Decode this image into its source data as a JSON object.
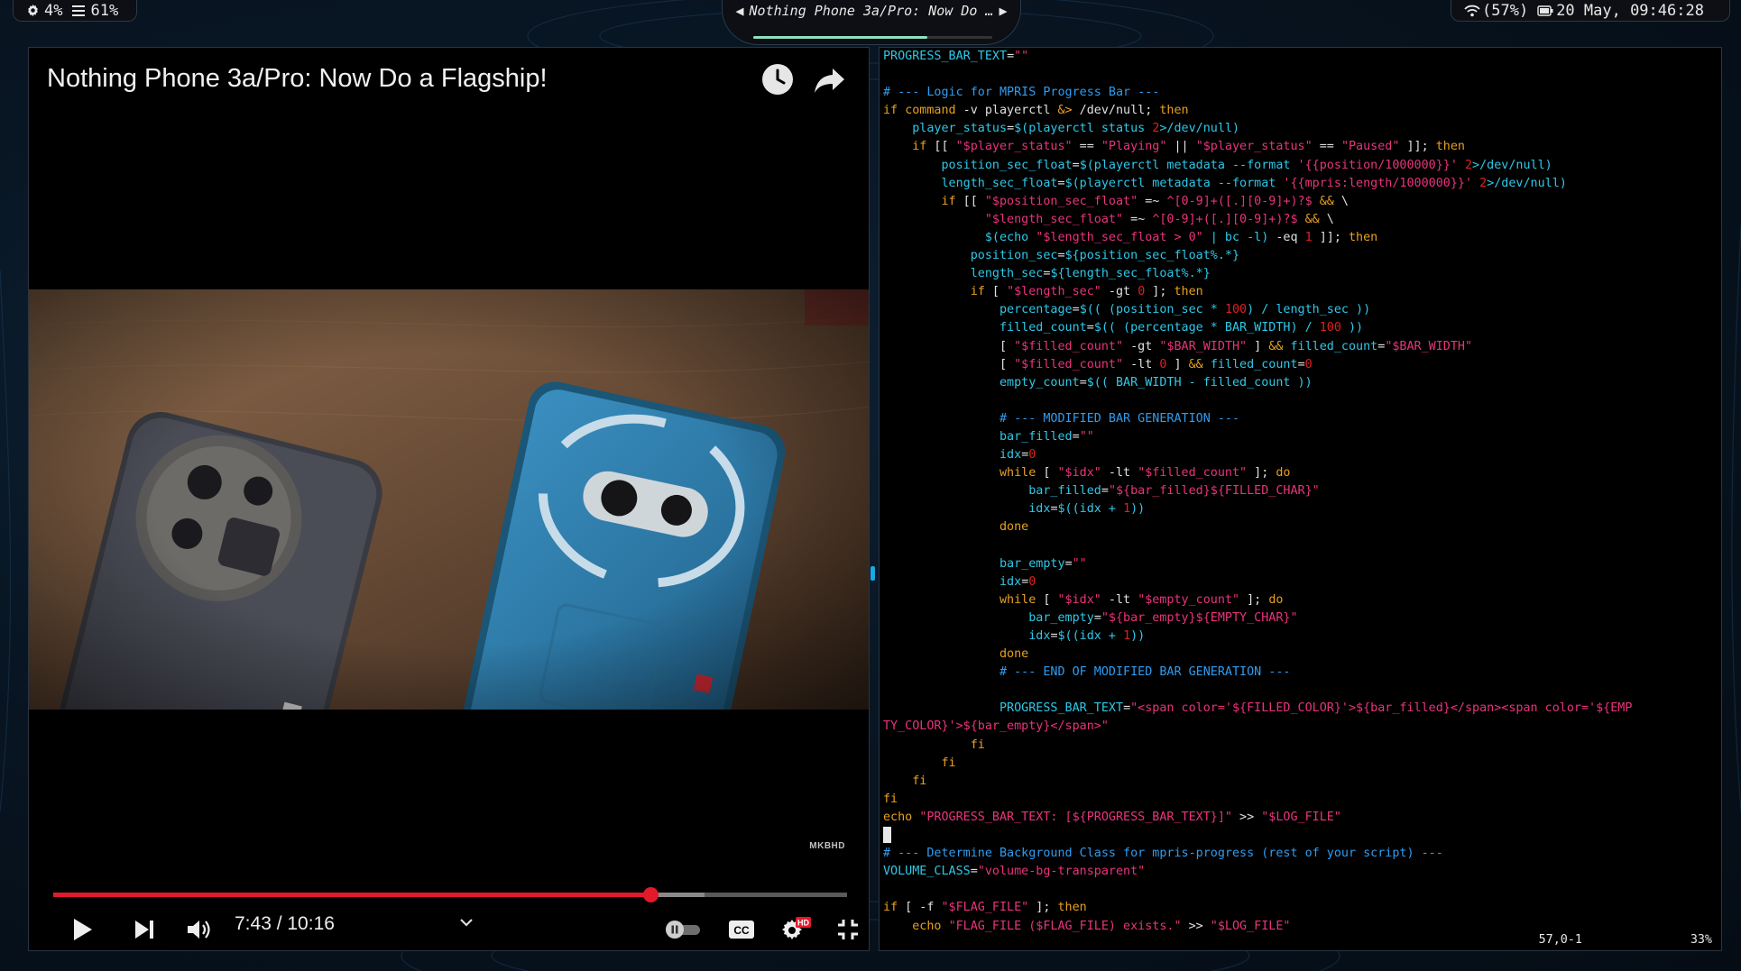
{
  "topbar": {
    "cpu_icon": "gear-icon",
    "cpu": "4%",
    "mem_icon": "menu-icon",
    "mem": "61%",
    "media_prev": "◀",
    "media_title": "Nothing Phone 3a/Pro: Now Do …",
    "media_next": "▶",
    "media_progress": 0.73,
    "wifi_icon": "wifi-icon",
    "wifi": "(57%)",
    "battery_icon": "battery-icon",
    "datetime": "20 May, 09:46:28"
  },
  "video": {
    "title": "Nothing Phone 3a/Pro: Now Do a Flagship!",
    "watch_later_icon": "clock-icon",
    "share_icon": "share-icon",
    "watermark": "MKBHD",
    "time": "7:43 / 10:16",
    "progress": 0.7524,
    "buffered": 0.82,
    "controls": [
      "play-icon",
      "next-icon",
      "volume-icon",
      "chevron-down-icon",
      "autoplay-toggle",
      "cc-icon",
      "settings-icon",
      "exit-fullscreen-icon"
    ],
    "hd_badge": "HD",
    "cc_label": "CC",
    "colors": {
      "played": "#e21a2c"
    }
  },
  "terminal": {
    "lines": [
      [
        [
          "var",
          "PROGRESS_BAR_TEXT"
        ],
        [
          "op",
          "="
        ],
        [
          "str",
          "\"\""
        ]
      ],
      [],
      [
        [
          "cm",
          "# --- Logic for MPRIS Progress Bar ---"
        ]
      ],
      [
        [
          "kw",
          "if"
        ],
        [
          "op",
          " "
        ],
        [
          "kw",
          "command"
        ],
        [
          "op",
          " -v playerctl "
        ],
        [
          "kw",
          "&>"
        ],
        [
          "op",
          " /dev/null; "
        ],
        [
          "kw",
          "then"
        ]
      ],
      [
        [
          "op",
          "    "
        ],
        [
          "var",
          "player_status"
        ],
        [
          "op",
          "="
        ],
        [
          "var",
          "$(playerctl status "
        ],
        [
          "num",
          "2"
        ],
        [
          "var",
          ">/dev/null)"
        ]
      ],
      [
        [
          "op",
          "    "
        ],
        [
          "kw",
          "if"
        ],
        [
          "op",
          " [[ "
        ],
        [
          "str",
          "\"$player_status\""
        ],
        [
          "op",
          " == "
        ],
        [
          "str",
          "\"Playing\""
        ],
        [
          "op",
          " || "
        ],
        [
          "str",
          "\"$player_status\""
        ],
        [
          "op",
          " == "
        ],
        [
          "str",
          "\"Paused\""
        ],
        [
          "op",
          " ]]; "
        ],
        [
          "kw",
          "then"
        ]
      ],
      [
        [
          "op",
          "        "
        ],
        [
          "var",
          "position_sec_float"
        ],
        [
          "op",
          "="
        ],
        [
          "var",
          "$(playerctl metadata --format "
        ],
        [
          "str",
          "'{{position/1000000}}'"
        ],
        [
          "var",
          " "
        ],
        [
          "num",
          "2"
        ],
        [
          "var",
          ">/dev/null)"
        ]
      ],
      [
        [
          "op",
          "        "
        ],
        [
          "var",
          "length_sec_float"
        ],
        [
          "op",
          "="
        ],
        [
          "var",
          "$(playerctl metadata --format "
        ],
        [
          "str",
          "'{{mpris:length/1000000}}'"
        ],
        [
          "var",
          " "
        ],
        [
          "num",
          "2"
        ],
        [
          "var",
          ">/dev/null)"
        ]
      ],
      [
        [
          "op",
          "        "
        ],
        [
          "kw",
          "if"
        ],
        [
          "op",
          " [[ "
        ],
        [
          "str",
          "\"$position_sec_float\""
        ],
        [
          "op",
          " =~ "
        ],
        [
          "str",
          "^[0-9]+([.][0-9]+)?$"
        ],
        [
          "op",
          " "
        ],
        [
          "kw",
          "&&"
        ],
        [
          "op",
          " \\"
        ]
      ],
      [
        [
          "op",
          "              "
        ],
        [
          "str",
          "\"$length_sec_float\""
        ],
        [
          "op",
          " =~ "
        ],
        [
          "str",
          "^[0-9]+([.][0-9]+)?$"
        ],
        [
          "op",
          " "
        ],
        [
          "kw",
          "&&"
        ],
        [
          "op",
          " \\"
        ]
      ],
      [
        [
          "op",
          "              "
        ],
        [
          "var",
          "$(echo "
        ],
        [
          "str",
          "\"$length_sec_float > 0\""
        ],
        [
          "var",
          " | bc -l)"
        ],
        [
          "op",
          " -eq "
        ],
        [
          "num",
          "1"
        ],
        [
          "op",
          " ]]; "
        ],
        [
          "kw",
          "then"
        ]
      ],
      [
        [
          "op",
          "            "
        ],
        [
          "var",
          "position_sec"
        ],
        [
          "op",
          "="
        ],
        [
          "var",
          "${position_sec_float%.*}"
        ]
      ],
      [
        [
          "op",
          "            "
        ],
        [
          "var",
          "length_sec"
        ],
        [
          "op",
          "="
        ],
        [
          "var",
          "${length_sec_float%.*}"
        ]
      ],
      [
        [
          "op",
          "            "
        ],
        [
          "kw",
          "if"
        ],
        [
          "op",
          " [ "
        ],
        [
          "str",
          "\"$length_sec\""
        ],
        [
          "op",
          " -gt "
        ],
        [
          "num",
          "0"
        ],
        [
          "op",
          " ]; "
        ],
        [
          "kw",
          "then"
        ]
      ],
      [
        [
          "op",
          "                "
        ],
        [
          "var",
          "percentage"
        ],
        [
          "op",
          "="
        ],
        [
          "var",
          "$(( (position_sec * "
        ],
        [
          "num",
          "100"
        ],
        [
          "var",
          ") / length_sec ))"
        ]
      ],
      [
        [
          "op",
          "                "
        ],
        [
          "var",
          "filled_count"
        ],
        [
          "op",
          "="
        ],
        [
          "var",
          "$(( (percentage * BAR_WIDTH) / "
        ],
        [
          "num",
          "100"
        ],
        [
          "var",
          " ))"
        ]
      ],
      [
        [
          "op",
          "                [ "
        ],
        [
          "str",
          "\"$filled_count\""
        ],
        [
          "op",
          " -gt "
        ],
        [
          "str",
          "\"$BAR_WIDTH\""
        ],
        [
          "op",
          " ] "
        ],
        [
          "kw",
          "&&"
        ],
        [
          "op",
          " "
        ],
        [
          "var",
          "filled_count"
        ],
        [
          "op",
          "="
        ],
        [
          "str",
          "\"$BAR_WIDTH\""
        ]
      ],
      [
        [
          "op",
          "                [ "
        ],
        [
          "str",
          "\"$filled_count\""
        ],
        [
          "op",
          " -lt "
        ],
        [
          "num",
          "0"
        ],
        [
          "op",
          " ] "
        ],
        [
          "kw",
          "&&"
        ],
        [
          "op",
          " "
        ],
        [
          "var",
          "filled_count"
        ],
        [
          "op",
          "="
        ],
        [
          "num",
          "0"
        ]
      ],
      [
        [
          "op",
          "                "
        ],
        [
          "var",
          "empty_count"
        ],
        [
          "op",
          "="
        ],
        [
          "var",
          "$(( BAR_WIDTH - filled_count ))"
        ]
      ],
      [],
      [
        [
          "op",
          "                "
        ],
        [
          "cm",
          "# --- MODIFIED BAR GENERATION ---"
        ]
      ],
      [
        [
          "op",
          "                "
        ],
        [
          "var",
          "bar_filled"
        ],
        [
          "op",
          "="
        ],
        [
          "str",
          "\"\""
        ]
      ],
      [
        [
          "op",
          "                "
        ],
        [
          "var",
          "idx"
        ],
        [
          "op",
          "="
        ],
        [
          "num",
          "0"
        ]
      ],
      [
        [
          "op",
          "                "
        ],
        [
          "kw",
          "while"
        ],
        [
          "op",
          " [ "
        ],
        [
          "str",
          "\"$idx\""
        ],
        [
          "op",
          " -lt "
        ],
        [
          "str",
          "\"$filled_count\""
        ],
        [
          "op",
          " ]; "
        ],
        [
          "kw",
          "do"
        ]
      ],
      [
        [
          "op",
          "                    "
        ],
        [
          "var",
          "bar_filled"
        ],
        [
          "op",
          "="
        ],
        [
          "str",
          "\"${bar_filled}${FILLED_CHAR}\""
        ]
      ],
      [
        [
          "op",
          "                    "
        ],
        [
          "var",
          "idx"
        ],
        [
          "op",
          "="
        ],
        [
          "var",
          "$((idx + "
        ],
        [
          "num",
          "1"
        ],
        [
          "var",
          "))"
        ]
      ],
      [
        [
          "op",
          "                "
        ],
        [
          "kw",
          "done"
        ]
      ],
      [],
      [
        [
          "op",
          "                "
        ],
        [
          "var",
          "bar_empty"
        ],
        [
          "op",
          "="
        ],
        [
          "str",
          "\"\""
        ]
      ],
      [
        [
          "op",
          "                "
        ],
        [
          "var",
          "idx"
        ],
        [
          "op",
          "="
        ],
        [
          "num",
          "0"
        ]
      ],
      [
        [
          "op",
          "                "
        ],
        [
          "kw",
          "while"
        ],
        [
          "op",
          " [ "
        ],
        [
          "str",
          "\"$idx\""
        ],
        [
          "op",
          " -lt "
        ],
        [
          "str",
          "\"$empty_count\""
        ],
        [
          "op",
          " ]; "
        ],
        [
          "kw",
          "do"
        ]
      ],
      [
        [
          "op",
          "                    "
        ],
        [
          "var",
          "bar_empty"
        ],
        [
          "op",
          "="
        ],
        [
          "str",
          "\"${bar_empty}${EMPTY_CHAR}\""
        ]
      ],
      [
        [
          "op",
          "                    "
        ],
        [
          "var",
          "idx"
        ],
        [
          "op",
          "="
        ],
        [
          "var",
          "$((idx + "
        ],
        [
          "num",
          "1"
        ],
        [
          "var",
          "))"
        ]
      ],
      [
        [
          "op",
          "                "
        ],
        [
          "kw",
          "done"
        ]
      ],
      [
        [
          "op",
          "                "
        ],
        [
          "cm",
          "# --- END OF MODIFIED BAR GENERATION ---"
        ]
      ],
      [],
      [
        [
          "op",
          "                "
        ],
        [
          "var",
          "PROGRESS_BAR_TEXT"
        ],
        [
          "op",
          "="
        ],
        [
          "str",
          "\"<span color='${FILLED_COLOR}'>${bar_filled}</span><span color='${EMP"
        ]
      ],
      [
        [
          "str",
          "TY_COLOR}'>${bar_empty}</span>\""
        ]
      ],
      [
        [
          "op",
          "            "
        ],
        [
          "kw",
          "fi"
        ]
      ],
      [
        [
          "op",
          "        "
        ],
        [
          "kw",
          "fi"
        ]
      ],
      [
        [
          "op",
          "    "
        ],
        [
          "kw",
          "fi"
        ]
      ],
      [
        [
          "kw",
          "fi"
        ]
      ],
      [
        [
          "kw",
          "echo"
        ],
        [
          "op",
          " "
        ],
        [
          "str",
          "\"PROGRESS_BAR_TEXT: [${PROGRESS_BAR_TEXT}]\""
        ],
        [
          "op",
          " >> "
        ],
        [
          "str",
          "\"$LOG_FILE\""
        ]
      ],
      [
        [
          "cursor",
          ""
        ]
      ],
      [
        [
          "cm",
          "# --- Determine Background Class for mpris-progress (rest of your script) ---"
        ]
      ],
      [
        [
          "var",
          "VOLUME_CLASS"
        ],
        [
          "op",
          "="
        ],
        [
          "str",
          "\"volume-bg-transparent\""
        ]
      ],
      [],
      [
        [
          "kw",
          "if"
        ],
        [
          "op",
          " [ -f "
        ],
        [
          "str",
          "\"$FLAG_FILE\""
        ],
        [
          "op",
          " ]; "
        ],
        [
          "kw",
          "then"
        ]
      ],
      [
        [
          "op",
          "    "
        ],
        [
          "kw",
          "echo"
        ],
        [
          "op",
          " "
        ],
        [
          "str",
          "\"FLAG_FILE ($FLAG_FILE) exists.\""
        ],
        [
          "op",
          " >> "
        ],
        [
          "str",
          "\"$LOG_FILE\""
        ]
      ]
    ],
    "status_position": "57,0-1",
    "status_percent": "33%"
  }
}
